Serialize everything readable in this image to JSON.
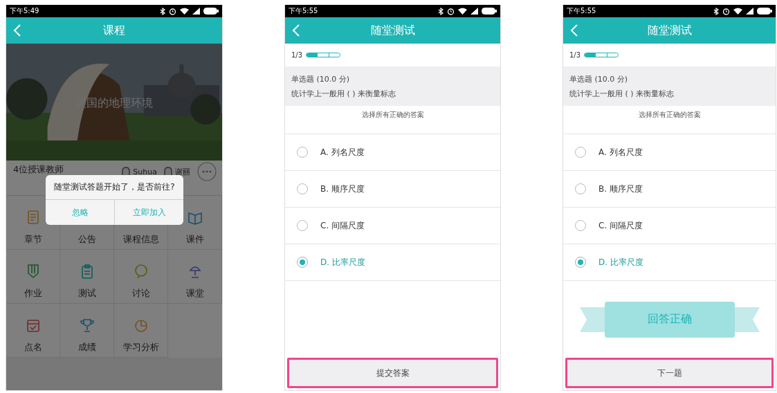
{
  "screens": [
    {
      "kind": "course",
      "status_time": "下午5:49",
      "title": "课程",
      "banner_caption": "美国的地理环境",
      "teachers_label": "4位授课教师",
      "teachers": [
        "Suhua",
        "谢丽"
      ],
      "tiles": [
        {
          "label": "章节"
        },
        {
          "label": "公告"
        },
        {
          "label": "课程信息"
        },
        {
          "label": "课件"
        },
        {
          "label": "作业"
        },
        {
          "label": "测试"
        },
        {
          "label": "讨论"
        },
        {
          "label": "课堂"
        },
        {
          "label": "点名"
        },
        {
          "label": "成绩"
        },
        {
          "label": "学习分析"
        }
      ],
      "dialog": {
        "message": "随堂测试答题开始了，是否前往?",
        "buttons": [
          "忽略",
          "立即加入"
        ]
      }
    },
    {
      "kind": "quiz",
      "status_time": "下午5:55",
      "title": "随堂测试",
      "progress": {
        "text": "1/3",
        "level": 0.333
      },
      "question_type": "单选题 (10.0 分)",
      "question": "统计学上一般用 ( ) 来衡量标志",
      "hint": "选择所有正确的答案",
      "options": [
        {
          "letter": "A.",
          "text": "列名尺度",
          "selected": false
        },
        {
          "letter": "B.",
          "text": "顺序尺度",
          "selected": false
        },
        {
          "letter": "C.",
          "text": "间隔尺度",
          "selected": false
        },
        {
          "letter": "D.",
          "text": "比率尺度",
          "selected": true
        }
      ],
      "action": {
        "label": "提交答案",
        "highlighted": true
      }
    },
    {
      "kind": "quiz",
      "status_time": "下午5:55",
      "title": "随堂测试",
      "progress": {
        "text": "1/3",
        "level": 0.333
      },
      "question_type": "单选题 (10.0 分)",
      "question": "统计学上一般用 ( ) 来衡量标志",
      "hint": "选择所有正确的答案",
      "options": [
        {
          "letter": "A.",
          "text": "列名尺度",
          "selected": false
        },
        {
          "letter": "B.",
          "text": "顺序尺度",
          "selected": false
        },
        {
          "letter": "C.",
          "text": "间隔尺度",
          "selected": false
        },
        {
          "letter": "D.",
          "text": "比率尺度",
          "selected": true
        }
      ],
      "result": "回答正确",
      "action": {
        "label": "下一题",
        "highlighted": true
      }
    }
  ]
}
